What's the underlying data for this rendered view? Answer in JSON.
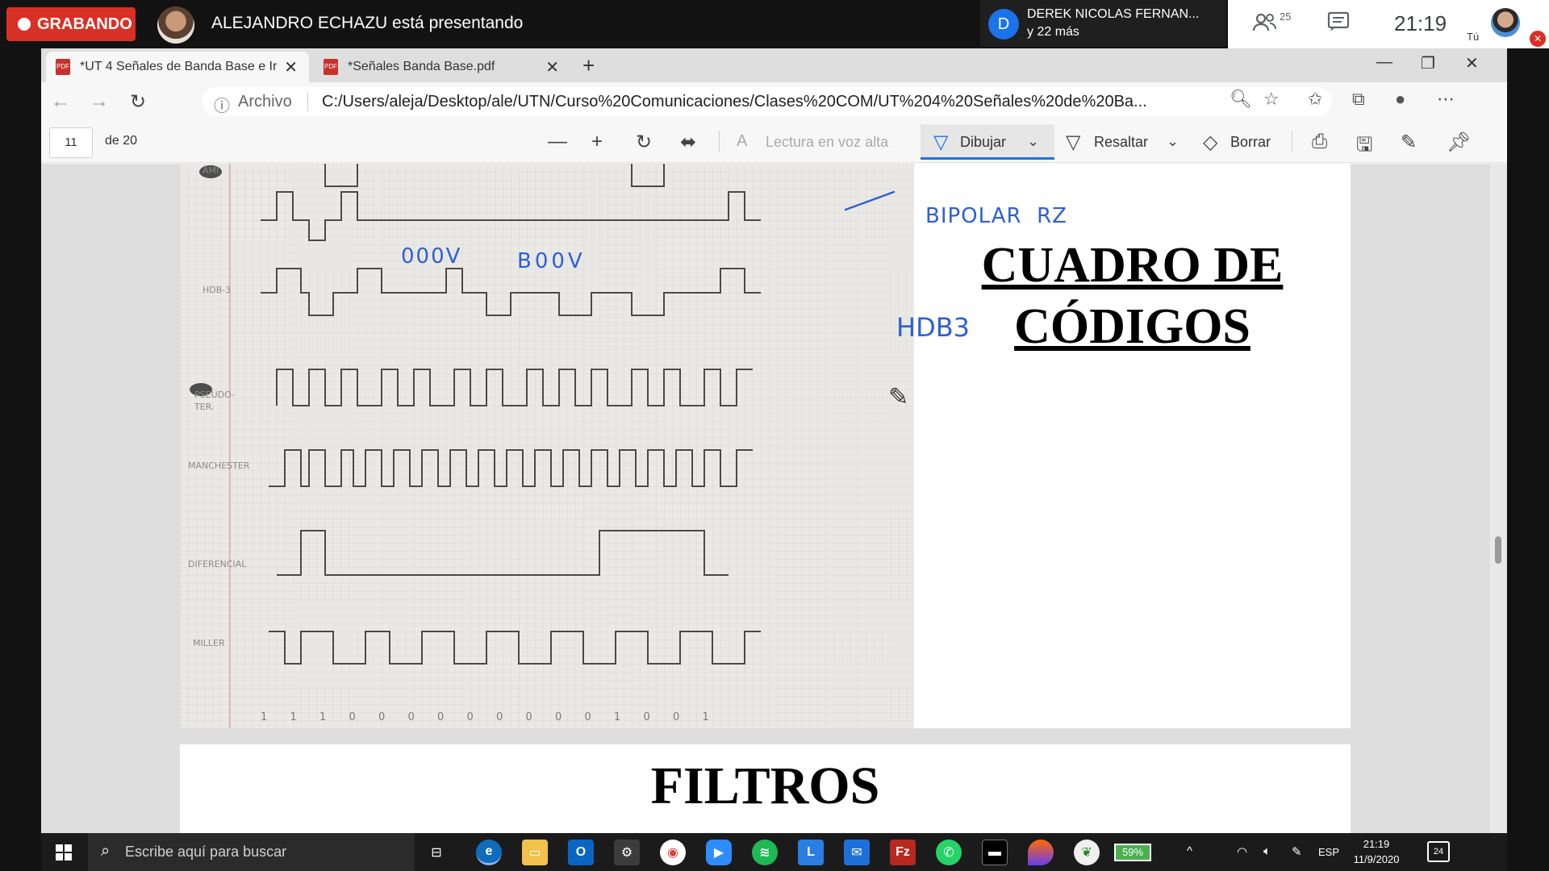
{
  "meet": {
    "recording_label": "GRABANDO",
    "presenter_text": "ALEJANDRO ECHAZU está presentando",
    "participant_initial": "D",
    "participant_name": "DEREK NICOLAS FERNAN...",
    "participant_more": "y 22 más",
    "people_count": "25",
    "clock": "21:19",
    "self_label": "Tú"
  },
  "browser": {
    "tabs": [
      {
        "label": "*UT 4 Señales de Banda Base e Ir"
      },
      {
        "label": "*Señales Banda Base.pdf"
      }
    ],
    "address": {
      "scheme_label": "Archivo",
      "url": "C:/Users/aleja/Desktop/ale/UTN/Curso%20Comunicaciones/Clases%20COM/UT%204%20Señales%20de%20Ba..."
    }
  },
  "pdf_toolbar": {
    "page_current": "11",
    "page_total": "de 20",
    "read_aloud": "Lectura en voz alta",
    "draw": "Dibujar",
    "highlight": "Resaltar",
    "erase": "Borrar"
  },
  "pdf": {
    "page11_title_line1": "CUADRO DE",
    "page11_title_line2": "CÓDIGOS",
    "annotation_bipolar": "BIPOLAR  RZ",
    "annotation_hdb3": "HDB3",
    "annotation_000v": "000V",
    "annotation_b00v": "B00V",
    "page12_title": "FILTROS",
    "bit_sequence": [
      "1",
      "1",
      "1",
      "0",
      "0",
      "0",
      "0",
      "0",
      "0",
      "0",
      "0",
      "0",
      "1",
      "0",
      "0",
      "1"
    ]
  },
  "taskbar": {
    "search_placeholder": "Escribe aquí para buscar",
    "battery": "59%",
    "language": "ESP",
    "time": "21:19",
    "date": "11/9/2020",
    "notifications": "24"
  }
}
